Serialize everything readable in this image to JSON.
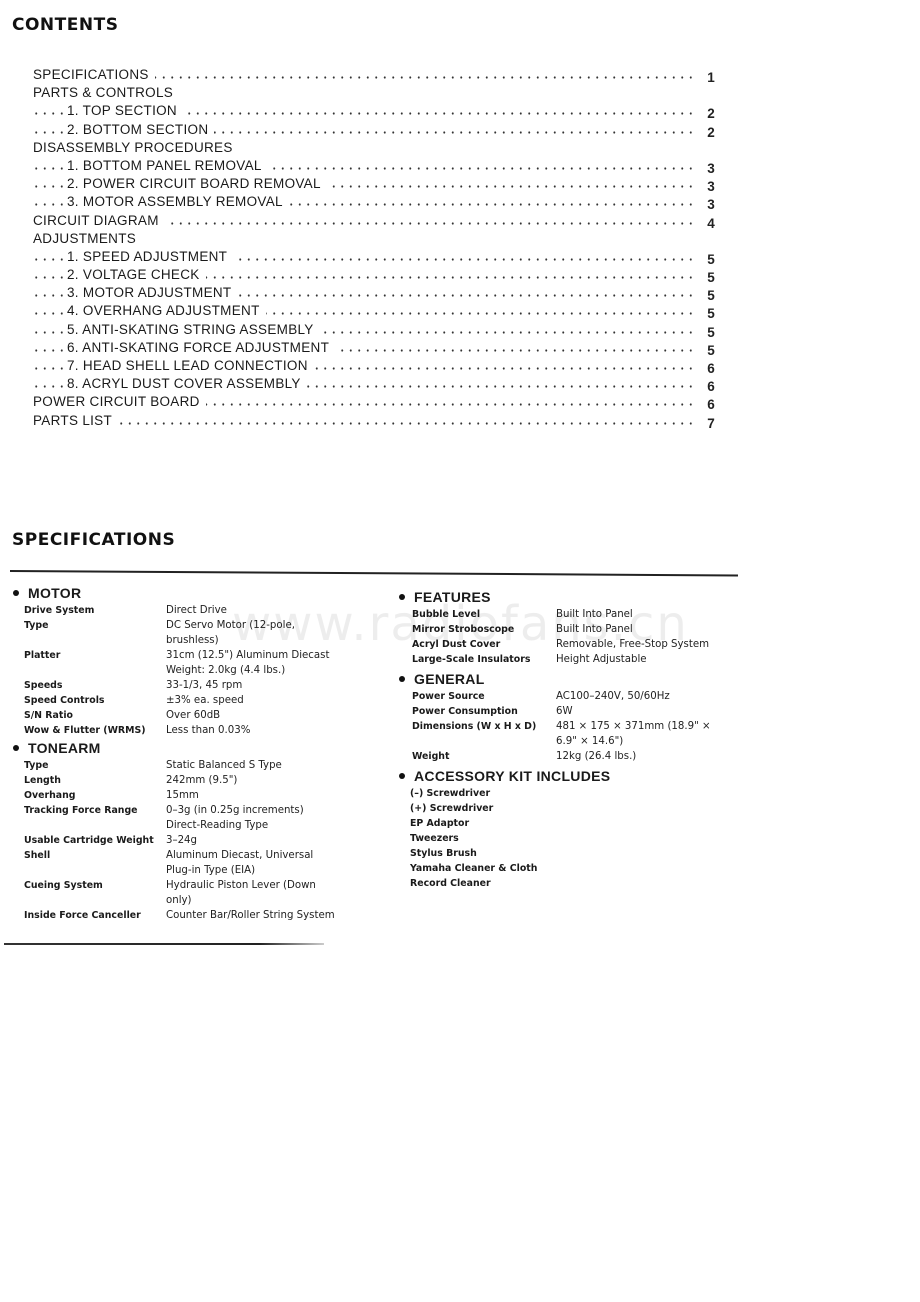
{
  "contents": {
    "title": "CONTENTS",
    "entries": [
      {
        "label": "SPECIFICATIONS",
        "page": "1",
        "level": 0
      },
      {
        "label": "PARTS & CONTROLS",
        "page": "",
        "level": 0
      },
      {
        "label": "1. TOP SECTION",
        "page": "2",
        "level": 1
      },
      {
        "label": "2. BOTTOM SECTION",
        "page": "2",
        "level": 1
      },
      {
        "label": "DISASSEMBLY PROCEDURES",
        "page": "",
        "level": 0
      },
      {
        "label": "1. BOTTOM PANEL REMOVAL",
        "page": "3",
        "level": 1
      },
      {
        "label": "2. POWER CIRCUIT BOARD REMOVAL",
        "page": "3",
        "level": 1
      },
      {
        "label": "3. MOTOR ASSEMBLY REMOVAL",
        "page": "3",
        "level": 1
      },
      {
        "label": "CIRCUIT DIAGRAM",
        "page": "4",
        "level": 0
      },
      {
        "label": "ADJUSTMENTS",
        "page": "",
        "level": 0
      },
      {
        "label": "1. SPEED ADJUSTMENT",
        "page": "5",
        "level": 1
      },
      {
        "label": "2. VOLTAGE CHECK",
        "page": "5",
        "level": 1
      },
      {
        "label": "3. MOTOR ADJUSTMENT",
        "page": "5",
        "level": 1
      },
      {
        "label": "4. OVERHANG ADJUSTMENT",
        "page": "5",
        "level": 1
      },
      {
        "label": "5. ANTI-SKATING STRING ASSEMBLY",
        "page": "5",
        "level": 1
      },
      {
        "label": "6. ANTI-SKATING FORCE ADJUSTMENT",
        "page": "5",
        "level": 1
      },
      {
        "label": "7. HEAD SHELL LEAD CONNECTION",
        "page": "6",
        "level": 1
      },
      {
        "label": "8. ACRYL DUST COVER ASSEMBLY",
        "page": "6",
        "level": 1
      },
      {
        "label": "POWER CIRCUIT BOARD",
        "page": "6",
        "level": 0
      },
      {
        "label": "PARTS LIST",
        "page": "7",
        "level": 0
      }
    ]
  },
  "specifications": {
    "title": "SPECIFICATIONS",
    "watermark": "www.radiofans.cn",
    "motor": {
      "heading": "MOTOR",
      "rows": [
        {
          "label": "Drive System",
          "value": "Direct Drive"
        },
        {
          "label": "Type",
          "value": "DC  Servo  Motor  (12-pole,\n          brushless)"
        },
        {
          "label": "Platter",
          "value": "31cm (12.5\") Aluminum Diecast\nWeight: 2.0kg (4.4 lbs.)"
        },
        {
          "label": "Speeds",
          "value": "33-1/3, 45 rpm"
        },
        {
          "label": "Speed Controls",
          "value": "±3% ea. speed"
        },
        {
          "label": "S/N Ratio",
          "value": "Over 60dB"
        },
        {
          "label": "Wow & Flutter (WRMS)",
          "value": "Less than 0.03%"
        }
      ]
    },
    "tonearm": {
      "heading": "TONEARM",
      "rows": [
        {
          "label": "Type",
          "value": "Static Balanced S Type"
        },
        {
          "label": "Length",
          "value": "242mm (9.5\")"
        },
        {
          "label": "Overhang",
          "value": "15mm"
        },
        {
          "label": "Tracking Force Range",
          "value": "0–3g (in 0.25g increments)\nDirect-Reading Type"
        },
        {
          "label": "Usable Cartridge Weight",
          "value": "3–24g"
        },
        {
          "label": "Shell",
          "value": "Aluminum Diecast, Universal\nPlug-in Type (EIA)"
        },
        {
          "label": "Cueing System",
          "value": "Hydraulic  Piston  Lever  (Down\nonly)"
        },
        {
          "label": "Inside Force Canceller",
          "value": "Counter Bar/Roller String System"
        }
      ]
    },
    "features": {
      "heading": "FEATURES",
      "rows": [
        {
          "label": "Bubble Level",
          "value": "Built Into Panel"
        },
        {
          "label": "Mirror Stroboscope",
          "value": "Built Into Panel"
        },
        {
          "label": "Acryl Dust Cover",
          "value": "Removable, Free-Stop System"
        },
        {
          "label": "Large-Scale Insulators",
          "value": "Height Adjustable"
        }
      ]
    },
    "general": {
      "heading": "GENERAL",
      "rows": [
        {
          "label": "Power Source",
          "value": "AC100–240V, 50/60Hz"
        },
        {
          "label": "Power Consumption",
          "value": "6W"
        },
        {
          "label": "Dimensions (W x H x D)",
          "value": "481 × 175 × 371mm (18.9\" ×\n6.9\" × 14.6\")"
        },
        {
          "label": "Weight",
          "value": "12kg (26.4 lbs.)"
        }
      ]
    },
    "accessory_kit": {
      "heading": "ACCESSORY KIT INCLUDES",
      "items": [
        "(–) Screwdriver",
        "(+) Screwdriver",
        "EP Adaptor",
        "Tweezers",
        "Stylus Brush",
        "Yamaha Cleaner & Cloth",
        "Record Cleaner"
      ]
    }
  }
}
